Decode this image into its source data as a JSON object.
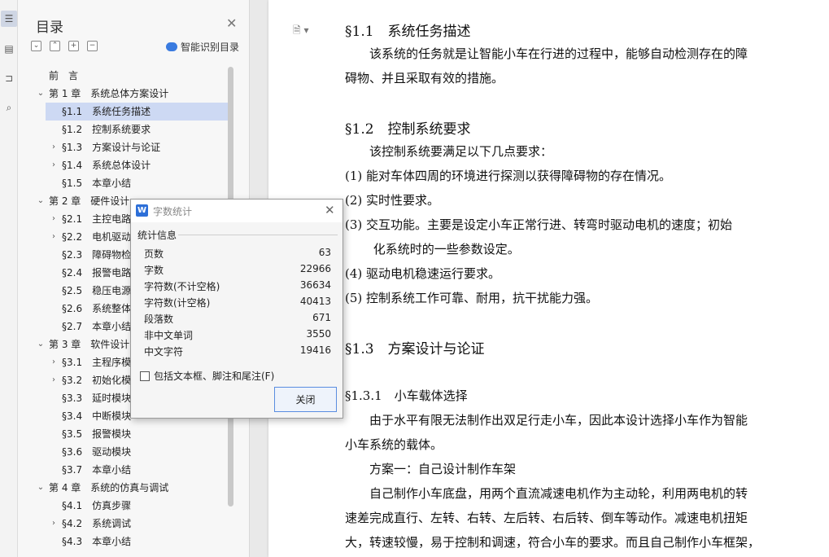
{
  "rail": {
    "icons": [
      "toc-icon",
      "list-icon",
      "bookmark-icon",
      "find-icon"
    ]
  },
  "toc": {
    "title": "目录",
    "smart_label": "智能识别目录",
    "items": [
      {
        "text": "前　言",
        "level": 1,
        "expand": ""
      },
      {
        "text": "第 1 章　系统总体方案设计",
        "level": 1,
        "expand": "down"
      },
      {
        "text": "§1.1　系统任务描述",
        "level": 2,
        "expand": "",
        "selected": true
      },
      {
        "text": "§1.2　控制系统要求",
        "level": 2,
        "expand": ""
      },
      {
        "text": "§1.3　方案设计与论证",
        "level": 2,
        "expand": "right"
      },
      {
        "text": "§1.4　系统总体设计",
        "level": 2,
        "expand": "right"
      },
      {
        "text": "§1.5　本章小结",
        "level": 2,
        "expand": ""
      },
      {
        "text": "第 2 章　硬件设计",
        "level": 1,
        "expand": "down"
      },
      {
        "text": "§2.1　主控电路设",
        "level": 2,
        "expand": "right"
      },
      {
        "text": "§2.2　电机驱动电",
        "level": 2,
        "expand": "right"
      },
      {
        "text": "§2.3　障碍物检测",
        "level": 2,
        "expand": ""
      },
      {
        "text": "§2.4　报警电路设",
        "level": 2,
        "expand": ""
      },
      {
        "text": "§2.5　稳压电源电",
        "level": 2,
        "expand": ""
      },
      {
        "text": "§2.6　系统整体电",
        "level": 2,
        "expand": ""
      },
      {
        "text": "§2.7　本章小结",
        "level": 2,
        "expand": ""
      },
      {
        "text": "第 3 章　软件设计简",
        "level": 1,
        "expand": "down"
      },
      {
        "text": "§3.1　主程序模块",
        "level": 2,
        "expand": "right"
      },
      {
        "text": "§3.2　初始化模块",
        "level": 2,
        "expand": "right"
      },
      {
        "text": "§3.3　延时模块",
        "level": 2,
        "expand": ""
      },
      {
        "text": "§3.4　中断模块",
        "level": 2,
        "expand": ""
      },
      {
        "text": "§3.5　报警模块",
        "level": 2,
        "expand": ""
      },
      {
        "text": "§3.6　驱动模块",
        "level": 2,
        "expand": ""
      },
      {
        "text": "§3.7　本章小结",
        "level": 2,
        "expand": ""
      },
      {
        "text": "第 4 章　系统的仿真与调试",
        "level": 1,
        "expand": "down"
      },
      {
        "text": "§4.1　仿真步骤",
        "level": 2,
        "expand": ""
      },
      {
        "text": "§4.2　系统调试",
        "level": 2,
        "expand": "right"
      },
      {
        "text": "§4.3　本章小结",
        "level": 2,
        "expand": ""
      }
    ]
  },
  "doc": {
    "lines": [
      {
        "text": "§1.1　系统任务描述",
        "kind": "h2"
      },
      {
        "text": "　　该系统的任务就是让智能小车在行进的过程中，能够自动检测存在的障",
        "kind": "p"
      },
      {
        "text": "碍物、并且采取有效的措施。",
        "kind": "p"
      },
      {
        "text": "§1.2　控制系统要求",
        "kind": "h2"
      },
      {
        "text": "　　该控制系统要满足以下几点要求：",
        "kind": "p"
      },
      {
        "text": " (1)  能对车体四周的环境进行探测以获得障碍物的存在情况。",
        "kind": "p"
      },
      {
        "text": " (2)  实时性要求。",
        "kind": "p"
      },
      {
        "text": " (3)  交互功能。主要是设定小车正常行进、转弯时驱动电机的速度；初始",
        "kind": "p"
      },
      {
        "text": "　　 化系统时的一些参数设定。",
        "kind": "p"
      },
      {
        "text": " (4)  驱动电机稳速运行要求。",
        "kind": "p"
      },
      {
        "text": " (5)  控制系统工作可靠、耐用，抗干扰能力强。",
        "kind": "p"
      },
      {
        "text": "§1.3　方案设计与论证",
        "kind": "h2"
      },
      {
        "text": "§1.3.1　小车载体选择",
        "kind": "h3"
      },
      {
        "text": "　　由于水平有限无法制作出双足行走小车，因此本设计选择小车作为智能",
        "kind": "p"
      },
      {
        "text": "小车系统的载体。",
        "kind": "p"
      },
      {
        "text": "　　方案一：自己设计制作车架",
        "kind": "p"
      },
      {
        "text": "　　自己制作小车底盘，用两个直流减速电机作为主动轮，利用两电机的转",
        "kind": "p"
      },
      {
        "text": "速差完成直行、左转、右转、左后转、右后转、倒车等动作。减速电机扭矩",
        "kind": "p"
      },
      {
        "text": "大，转速较慢，易于控制和调速，符合小车的要求。而且自己制作小车框架，",
        "kind": "p"
      }
    ]
  },
  "dialog": {
    "title": "字数统计",
    "group_label": "统计信息",
    "stats": [
      {
        "label": "页数",
        "value": "63"
      },
      {
        "label": "字数",
        "value": "22966"
      },
      {
        "label": "字符数(不计空格)",
        "value": "36634"
      },
      {
        "label": "字符数(计空格)",
        "value": "40413"
      },
      {
        "label": "段落数",
        "value": "671"
      },
      {
        "label": "非中文单词",
        "value": "3550"
      },
      {
        "label": "中文字符",
        "value": "19416"
      }
    ],
    "checkbox_label": "包括文本框、脚注和尾注(F)",
    "close_label": "关闭"
  }
}
